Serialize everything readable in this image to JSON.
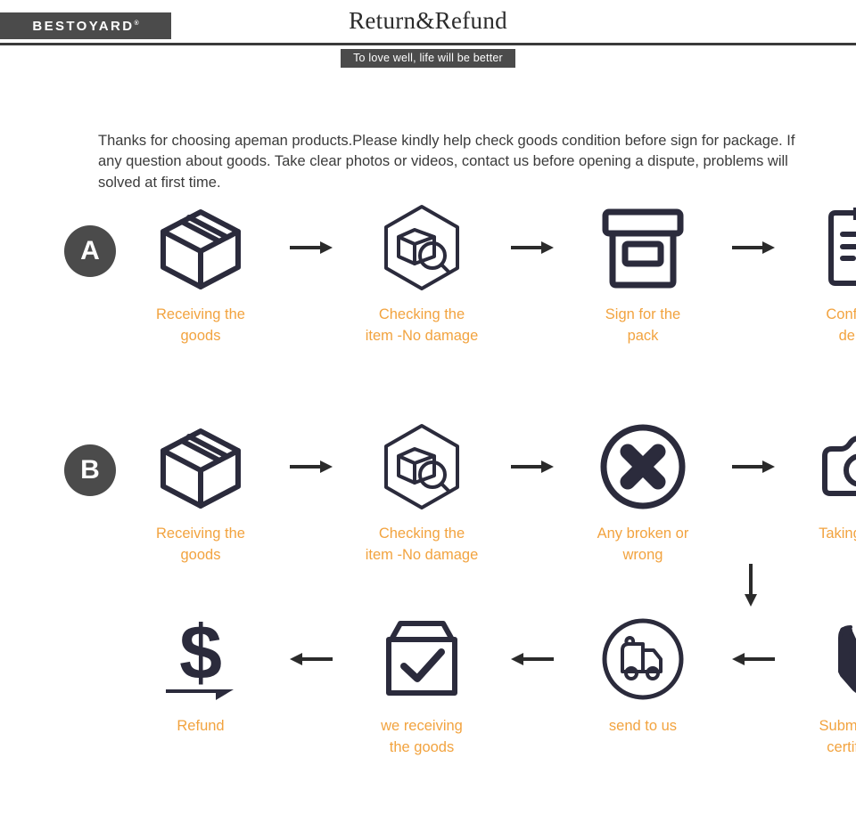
{
  "header": {
    "logo_text": "BESTOYARD",
    "logo_registered_mark": "®",
    "title": "Return&Refund",
    "tagline": "To love well, life will be better"
  },
  "intro": {
    "paragraph": "Thanks for choosing apeman products.Please kindly help check goods condition before sign for package. If any question about goods. Take clear photos or videos, contact us before opening a dispute, problems will solved at first time."
  },
  "colors": {
    "accent_orange": "#f2a33f",
    "icon_dark": "#2b2b3c",
    "badge_gray": "#4b4b4b",
    "text_gray": "#3b3b3b"
  },
  "flows": [
    {
      "id": "A",
      "badge_label": "A",
      "steps": [
        {
          "icon": "box-icon",
          "label": "Receiving the\ngoods"
        },
        {
          "icon": "inspect-package-hexagon-icon",
          "label": "Checking the\nitem -No damage"
        },
        {
          "icon": "sign-package-icon",
          "label": "Sign for the\npack"
        },
        {
          "icon": "clipboard-check-icon",
          "label": "Confirm the\ndelivery"
        }
      ],
      "arrows": [
        "arrow-right-icon",
        "arrow-right-icon",
        "arrow-right-icon"
      ]
    },
    {
      "id": "B",
      "badge_label": "B",
      "steps": [
        {
          "icon": "box-icon",
          "label": "Receiving the\ngoods"
        },
        {
          "icon": "inspect-package-hexagon-icon",
          "label": "Checking the\nitem -No damage"
        },
        {
          "icon": "x-circle-icon",
          "label": "Any broken or\nwrong"
        },
        {
          "icon": "camera-icon",
          "label": "Taking photos"
        }
      ],
      "arrows": [
        "arrow-right-icon",
        "arrow-right-icon",
        "arrow-right-icon"
      ],
      "down_arrow": "arrow-down-icon"
    },
    {
      "id": "C",
      "steps": [
        {
          "icon": "dollar-refund-icon",
          "label": "Refund"
        },
        {
          "icon": "box-check-icon",
          "label": "we receiving\nthe goods"
        },
        {
          "icon": "truck-circle-icon",
          "label": "send  to us"
        },
        {
          "icon": "upload-certification-icon",
          "label": "Submiting the\ncertification"
        }
      ],
      "arrows": [
        "arrow-left-icon",
        "arrow-left-icon",
        "arrow-left-icon"
      ]
    }
  ]
}
